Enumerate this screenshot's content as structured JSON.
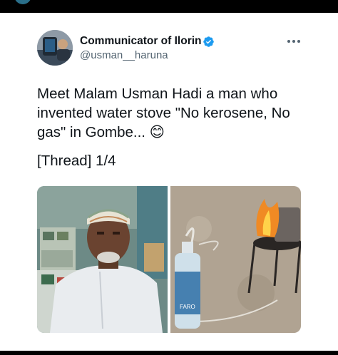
{
  "author": {
    "display_name": "Communicator of Ilorin",
    "handle": "@usman__haruna",
    "verified": true
  },
  "tweet": {
    "text": "Meet Malam Usman Hadi a man who invented water stove \"No kerosene, No gas\" in Gombe... 😊",
    "thread_label": "[Thread] 1/4"
  },
  "media": {
    "bottle_label": "FARO"
  },
  "icons": {
    "verified": "verified-badge-icon",
    "more": "more-options-icon"
  },
  "colors": {
    "verified_blue": "#1d9bf0",
    "text_primary": "#0f1419",
    "text_secondary": "#536471"
  }
}
